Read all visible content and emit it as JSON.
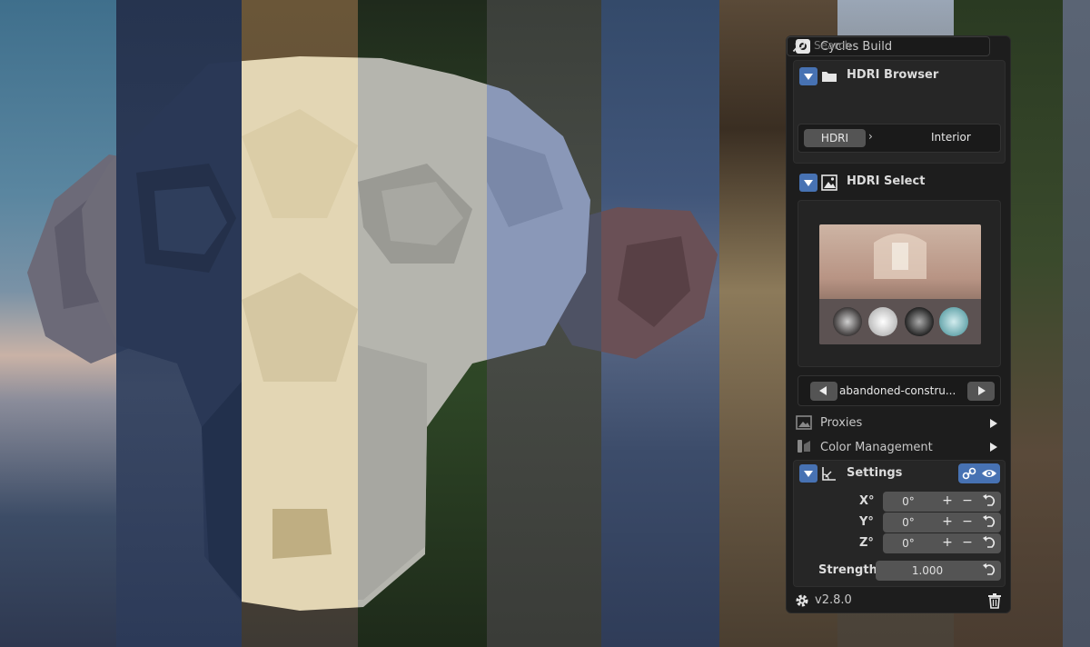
{
  "panel": {
    "title": "Cycles Build",
    "hdri_browser": {
      "title": "HDRI Browser",
      "search_placeholder": "Search",
      "breadcrumb_root": "HDRI",
      "breadcrumb_current": "Interior"
    },
    "hdri_select": {
      "title": "HDRI Select",
      "current_name": "abandoned-constru..."
    },
    "proxies": {
      "title": "Proxies"
    },
    "color_management": {
      "title": "Color Management"
    },
    "settings": {
      "title": "Settings",
      "x_label": "X°",
      "x_value": "0°",
      "y_label": "Y°",
      "y_value": "0°",
      "z_label": "Z°",
      "z_value": "0°",
      "strength_label": "Strength",
      "strength_value": "1.000"
    },
    "version": "v2.8.0",
    "plus": "+",
    "minus": "−"
  },
  "colors": {
    "accent": "#4772b3",
    "panel_bg": "#1d1d1d",
    "field_bg": "#545454"
  },
  "icons": [
    "blender-logo-icon",
    "folder-icon",
    "search-icon",
    "image-icon",
    "chevron-right-icon",
    "prev-icon",
    "next-icon",
    "proxies-icon",
    "color-management-icon",
    "axes-icon",
    "link-icon",
    "eye-icon",
    "reset-icon",
    "gear-icon",
    "trash-icon"
  ]
}
